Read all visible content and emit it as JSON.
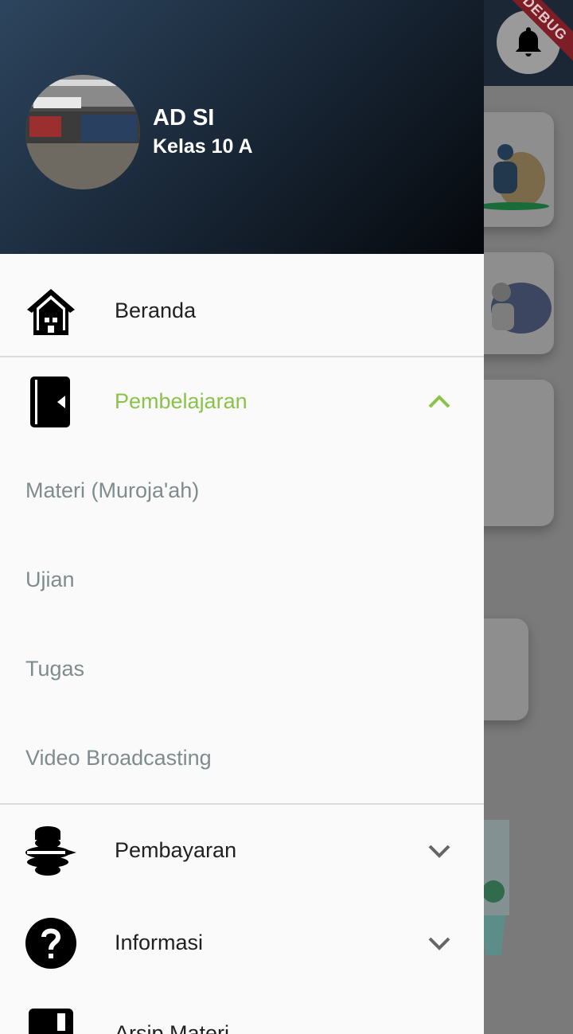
{
  "debug_banner": "DEBUG",
  "user": {
    "name": "AD SI",
    "class": "Kelas 10 A"
  },
  "menu": {
    "home": {
      "label": "Beranda"
    },
    "learning": {
      "label": "Pembelajaran",
      "expanded": true,
      "accent_color": "#8bc34a",
      "subitems": [
        "Materi (Muroja'ah)",
        "Ujian",
        "Tugas",
        "Video Broadcasting"
      ]
    },
    "payment": {
      "label": "Pembayaran"
    },
    "info": {
      "label": "Informasi"
    },
    "archive": {
      "label": "Arsip Materi"
    }
  },
  "icons": {
    "home": "home-icon",
    "learning": "book-icon",
    "payment": "database-icon",
    "info": "help-icon",
    "archive": "archive-icon",
    "notifications": "bell-icon"
  }
}
